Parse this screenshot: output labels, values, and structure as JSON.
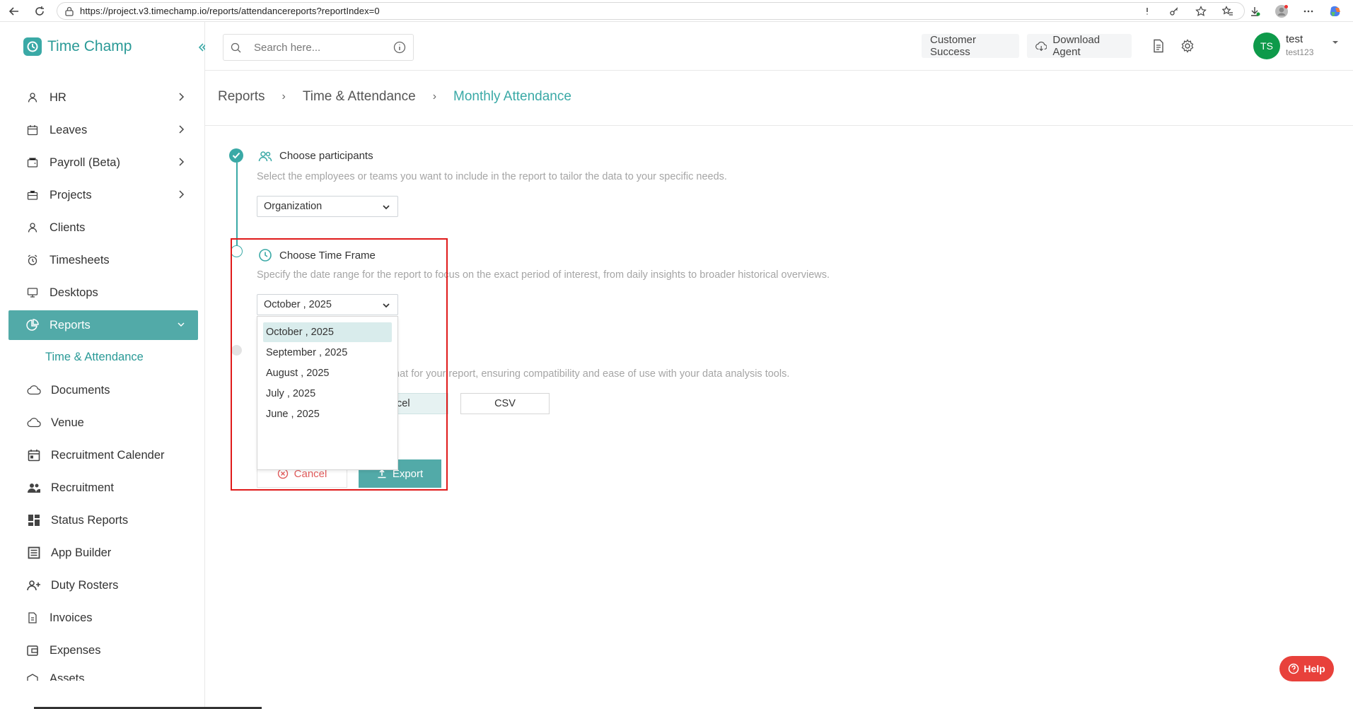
{
  "browser": {
    "url": "https://project.v3.timechamp.io/reports/attendancereports?reportIndex=0"
  },
  "brand": {
    "name": "Time Champ"
  },
  "sidebar": {
    "items": [
      {
        "label": "HR",
        "icon": "person-icon",
        "has_chevron": true
      },
      {
        "label": "Leaves",
        "icon": "calendar-icon",
        "has_chevron": true
      },
      {
        "label": "Payroll (Beta)",
        "icon": "wallet-icon",
        "has_chevron": true
      },
      {
        "label": "Projects",
        "icon": "briefcase-icon",
        "has_chevron": true
      },
      {
        "label": "Clients",
        "icon": "person-icon",
        "has_chevron": false
      },
      {
        "label": "Timesheets",
        "icon": "alarm-clock-icon",
        "has_chevron": false
      },
      {
        "label": "Desktops",
        "icon": "monitor-icon",
        "has_chevron": false
      },
      {
        "label": "Reports",
        "icon": "pie-chart-icon",
        "has_chevron": true,
        "active": true
      }
    ],
    "submenu": [
      "Time & Attendance"
    ],
    "items_after": [
      {
        "label": "Documents",
        "icon": "cloud-icon"
      },
      {
        "label": "Venue",
        "icon": "cloud-icon"
      },
      {
        "label": "Recruitment Calender",
        "icon": "calendar-icon"
      },
      {
        "label": "Recruitment",
        "icon": "group-icon"
      },
      {
        "label": "Status Reports",
        "icon": "dashboard-icon"
      },
      {
        "label": "App Builder",
        "icon": "list-icon"
      },
      {
        "label": "Duty Rosters",
        "icon": "person-add-icon"
      },
      {
        "label": "Invoices",
        "icon": "document-icon"
      },
      {
        "label": "Expenses",
        "icon": "wallet-icon"
      },
      {
        "label": "Assets",
        "icon": "box-icon"
      }
    ]
  },
  "topbar": {
    "search_placeholder": "Search here...",
    "customer_success": "Customer Success",
    "download_agent": "Download Agent",
    "user": {
      "initials": "TS",
      "name": "test",
      "sub": "test123"
    }
  },
  "breadcrumb": [
    "Reports",
    "Time & Attendance",
    "Monthly Attendance"
  ],
  "steps": {
    "participants": {
      "title": "Choose participants",
      "desc": "Select the employees or teams you want to include in the report to tailor the data to your specific needs.",
      "value": "Organization"
    },
    "timeframe": {
      "title": "Choose Time Frame",
      "desc": "Specify the date range for the report to focus on the exact period of interest, from daily insights to broader historical overviews.",
      "value": "October , 2025",
      "options": [
        "October , 2025",
        "September , 2025",
        "August , 2025",
        "July , 2025",
        "June , 2025"
      ]
    },
    "format": {
      "desc_visible": "mat for your report, ensuring compatibility and ease of use with your data analysis tools.",
      "excel_visible": "cel",
      "csv": "CSV"
    }
  },
  "actions": {
    "cancel": "Cancel",
    "export": "Export"
  },
  "help": {
    "label": "Help"
  },
  "colors": {
    "accent": "#52aaa8",
    "brand": "#2a9a97",
    "highlight": "#e01a1a",
    "help": "#e8413b",
    "avatar": "#0e9a4a"
  }
}
